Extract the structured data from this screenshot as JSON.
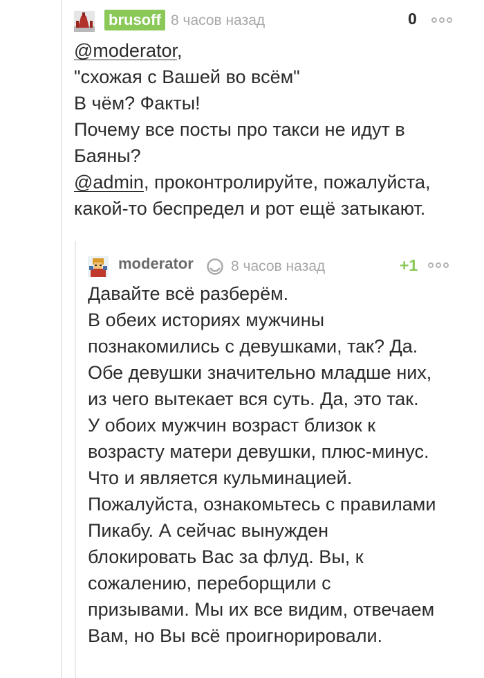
{
  "comment1": {
    "username": "brusoff",
    "time": "8 часов назад",
    "rating": "0",
    "line1_mention": "@moderator",
    "line1_rest": ",",
    "line2": "\"схожая с Вашей во всём\"",
    "line3": "В чём? Факты!",
    "line4": "Почему все посты про такси не идут в",
    "line5": "Баяны?",
    "line6_mention": "@admin",
    "line6_rest": ", проконтролируйте, пожалуйста,",
    "line7": "какой-то беспредел и рот ещё затыкают."
  },
  "comment2": {
    "username": "moderator",
    "time": "8 часов назад",
    "rating": "+1",
    "lines": [
      "Давайте всё разберём.",
      "В обеих историях мужчины",
      "познакомились с девушками, так? Да.",
      "Обе девушки значительно младше них,",
      "из чего вытекает вся суть. Да, это так.",
      "У обоих мужчин возраст близок к",
      "возрасту матери девушки, плюс-минус.",
      "Что и является кульминацией.",
      "Пожалуйста, ознакомьтесь с правилами",
      "Пикабу. А сейчас вынужден",
      "блокировать Вас за флуд. Вы, к",
      "сожалению, переборщили с",
      "призывами. Мы их все видим, отвечаем",
      "Вам, но Вы всё проигнорировали."
    ]
  },
  "colors": {
    "accent_green": "#8ac858",
    "muted_gray": "#a7a7a7",
    "text": "#2b2b2b"
  },
  "icons": {
    "avatar1": "user-avatar-icon",
    "avatar2": "user-avatar-icon",
    "moderator_badge": "moderator-shield-icon",
    "more": "more-dots-icon"
  }
}
